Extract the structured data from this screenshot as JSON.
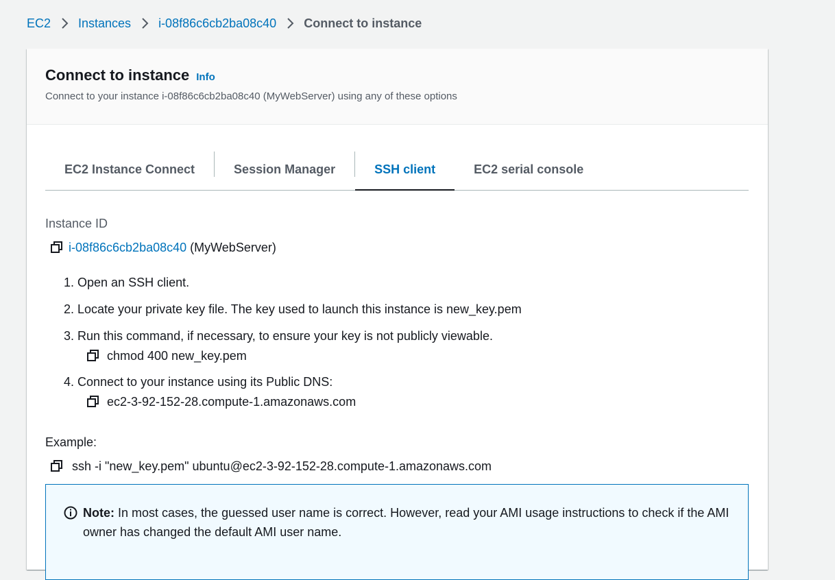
{
  "breadcrumb": {
    "items": [
      "EC2",
      "Instances",
      "i-08f86c6cb2ba08c40"
    ],
    "current": "Connect to instance"
  },
  "header": {
    "title": "Connect to instance",
    "info": "Info",
    "subtitle": "Connect to your instance i-08f86c6cb2ba08c40 (MyWebServer) using any of these options"
  },
  "tabs": [
    {
      "label": "EC2 Instance Connect"
    },
    {
      "label": "Session Manager"
    },
    {
      "label": "SSH client",
      "active": true
    },
    {
      "label": "EC2 serial console"
    }
  ],
  "instance": {
    "label": "Instance ID",
    "id": "i-08f86c6cb2ba08c40",
    "name": "(MyWebServer)"
  },
  "steps": [
    {
      "text": "1. Open an SSH client."
    },
    {
      "text": "2. Locate your private key file. The key used to launch this instance is new_key.pem"
    },
    {
      "text": "3. Run this command, if necessary, to ensure your key is not publicly viewable.",
      "code": "chmod 400 new_key.pem"
    },
    {
      "text": "4. Connect to your instance using its Public DNS:",
      "code": "ec2-3-92-152-28.compute-1.amazonaws.com"
    }
  ],
  "example": {
    "label": "Example:",
    "command": "ssh -i \"new_key.pem\" ubuntu@ec2-3-92-152-28.compute-1.amazonaws.com"
  },
  "note": {
    "bold": "Note:",
    "text": " In most cases, the guessed user name is correct. However, read your AMI usage instructions to check if the AMI owner has changed the default AMI user name."
  },
  "colors": {
    "link": "#0073bb",
    "note_bg": "#f1faff",
    "page_bg": "#f2f3f3"
  },
  "icons": {
    "copy": "copy-icon",
    "info": "info-circle-icon",
    "separator": "chevron-right-icon"
  }
}
